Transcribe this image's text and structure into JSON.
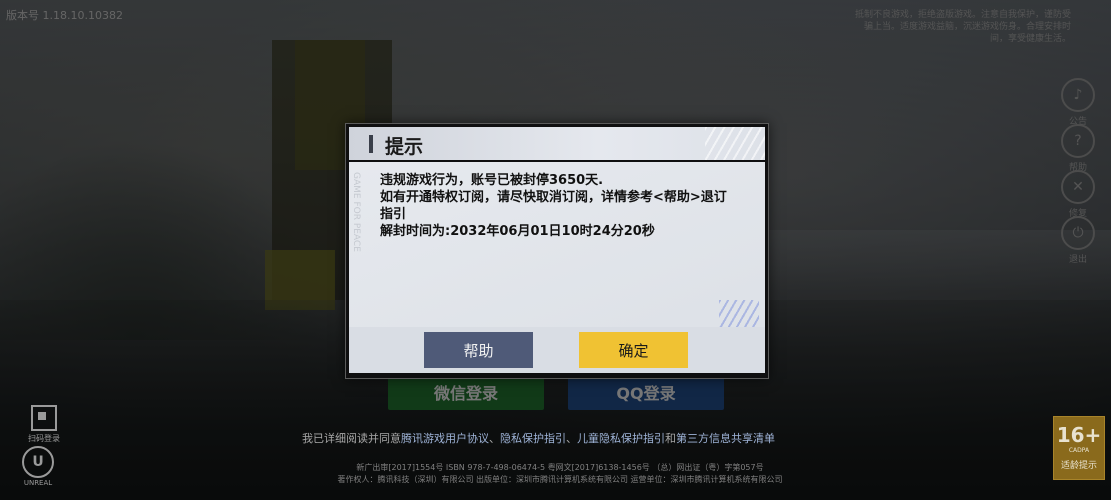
{
  "version_text": "版本号 1.18.10.10382",
  "notice_text": "抵制不良游戏，拒绝盗版游戏。注意自我保护，谨防受骗上当。适度游戏益脑，沉迷游戏伤身。合理安排时间，享受健康生活。",
  "side_buttons": [
    {
      "icon": "speaker-icon",
      "glyph": "♪",
      "label": "公告"
    },
    {
      "icon": "help-icon",
      "glyph": "?",
      "label": "帮助"
    },
    {
      "icon": "repair-icon",
      "glyph": "✕",
      "label": "修复"
    },
    {
      "icon": "power-icon",
      "glyph": "⏻",
      "label": "退出"
    }
  ],
  "login": {
    "wechat_label": "微信登录",
    "qq_label": "QQ登录"
  },
  "agreement": {
    "prefix": "我已详细阅读并同意",
    "link1": "腾讯游戏用户协议",
    "link2": "隐私保护指引",
    "link3": "儿童隐私保护指引",
    "middle": "和",
    "link4": "第三方信息共享清单"
  },
  "legal_lines": [
    "新广出审[2017]1554号  ISBN 978-7-498-06474-5  粤网文[2017]6138-1456号  （总）网出证（粤）字第057号",
    "著作权人：腾讯科技（深圳）有限公司  出版单位：深圳市腾讯计算机系统有限公司  运营单位：深圳市腾讯计算机系统有限公司"
  ],
  "qr_label": "扫码登录",
  "unreal_label": "UNREAL",
  "age_badge": {
    "number": "16+",
    "code": "CADPA",
    "label": "适龄提示"
  },
  "dialog": {
    "title": "提示",
    "watermark": "GAME FOR PEACE",
    "message_lines": [
      "违规游戏行为，账号已被封停3650天.",
      "如有开通特权订阅，请尽快取消订阅，详情参考<帮助>退订指引",
      "解封时间为:2032年06月01日10时24分20秒"
    ],
    "help_button": "帮助",
    "ok_button": "确定"
  }
}
